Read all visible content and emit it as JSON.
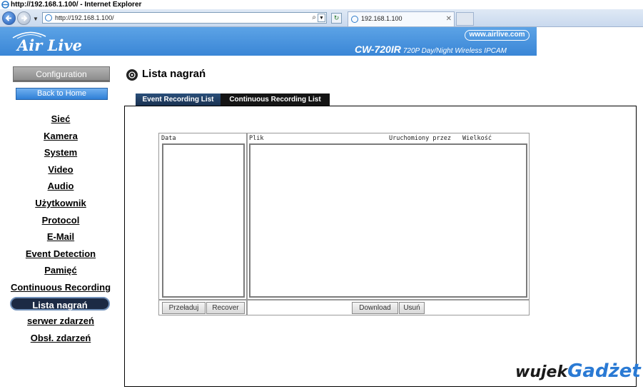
{
  "browser": {
    "window_title": "http://192.168.1.100/ - Internet Explorer",
    "address": "http://192.168.1.100/",
    "tab_label": "192.168.1.100",
    "tab_close": "✕"
  },
  "banner": {
    "logo": "Air Live",
    "website": "www.airlive.com",
    "model": "CW-720IR",
    "model_desc": "720P Day/Night Wireless IPCAM",
    "brand_color": "#3a86d6"
  },
  "sidebar": {
    "config_button": "Configuration",
    "home_button": "Back to Home",
    "items": [
      {
        "label": "Sieć"
      },
      {
        "label": "Kamera"
      },
      {
        "label": "System"
      },
      {
        "label": "Video"
      },
      {
        "label": "Audio"
      },
      {
        "label": "Użytkownik"
      },
      {
        "label": "Protocol"
      },
      {
        "label": "E-Mail"
      },
      {
        "label": "Event Detection"
      },
      {
        "label": "Pamięć"
      },
      {
        "label": "Continuous Recording"
      },
      {
        "label": "Lista nagrań",
        "active": true
      },
      {
        "label": "serwer zdarzeń"
      },
      {
        "label": "Obsł. zdarzeń"
      }
    ]
  },
  "main": {
    "title": "Lista nagrań",
    "tabs": [
      {
        "label": "Event Recording List"
      },
      {
        "label": "Continuous Recording List"
      }
    ],
    "left_list": {
      "header": "Data",
      "buttons": [
        "Przeładuj",
        "Recover"
      ]
    },
    "right_list": {
      "col_file": "Plik",
      "col_by": "Uruchomiony przez",
      "col_size": "Wielkość",
      "buttons": [
        "Download",
        "Usuń"
      ]
    }
  },
  "watermark": {
    "part1": "wujek",
    "part2": "Gadżet"
  }
}
